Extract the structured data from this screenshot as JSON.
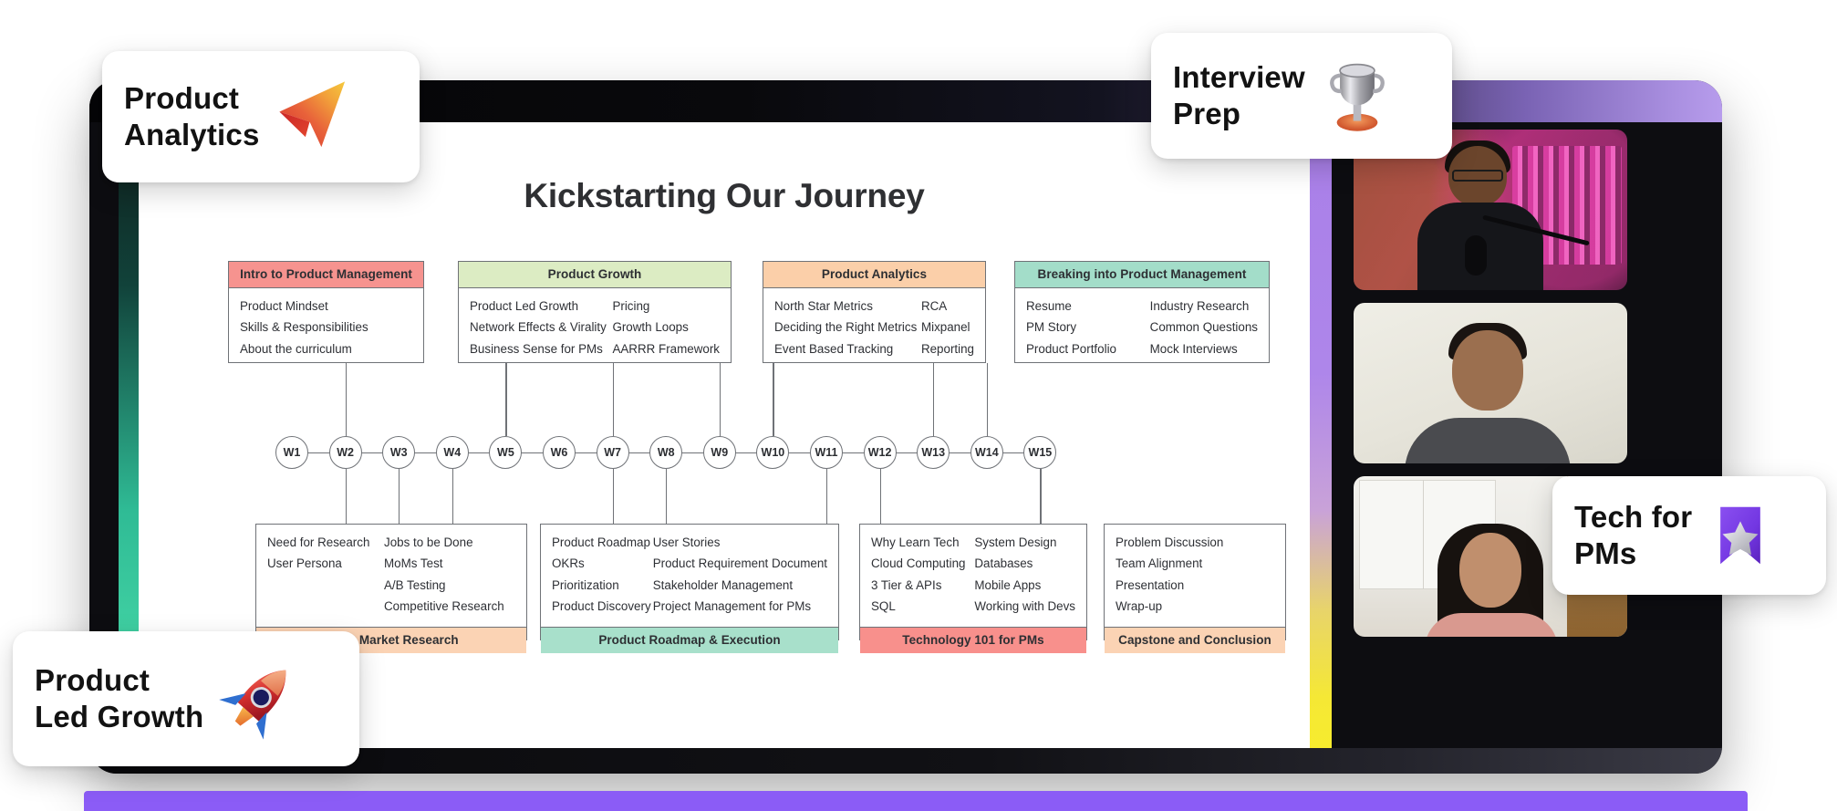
{
  "slide": {
    "title": "Kickstarting Our Journey",
    "modules_top": [
      {
        "title": "Intro to Product Management",
        "color": "#f6938f",
        "columns": [
          [
            "Product Mindset",
            "Skills & Responsibilities",
            "About the curriculum"
          ]
        ]
      },
      {
        "title": "Product Growth",
        "color": "#dcecc3",
        "columns": [
          [
            "Product Led Growth",
            "Network Effects & Virality",
            "Business Sense for PMs"
          ],
          [
            "Pricing",
            "Growth Loops",
            "AARRR Framework"
          ]
        ]
      },
      {
        "title": "Product Analytics",
        "color": "#fbcfa9",
        "columns": [
          [
            "North Star Metrics",
            "Deciding the Right Metrics",
            "Event Based Tracking"
          ],
          [
            "RCA",
            "Mixpanel",
            "Reporting"
          ]
        ]
      },
      {
        "title": "Breaking into Product Management",
        "color": "#a3ddc9",
        "columns": [
          [
            "Resume",
            "PM Story",
            "Product Portfolio"
          ],
          [
            "Industry Research",
            "Common Questions",
            "Mock Interviews"
          ]
        ]
      }
    ],
    "modules_bottom": [
      {
        "title": "rch & Market Research",
        "color": "#fbd3b4",
        "columns": [
          [
            "Need for Research",
            "User Persona"
          ],
          [
            "Jobs to be Done",
            "MoMs Test",
            "A/B Testing",
            "Competitive Research"
          ]
        ]
      },
      {
        "title": "Product Roadmap & Execution",
        "color": "#a8e0cb",
        "columns": [
          [
            "Product Roadmap",
            "OKRs",
            "Prioritization",
            "Product Discovery"
          ],
          [
            "User Stories",
            "Product Requirement Document",
            "Stakeholder Management",
            "Project Management for PMs"
          ]
        ]
      },
      {
        "title": "Technology 101 for PMs",
        "color": "#f8908c",
        "columns": [
          [
            "Why Learn Tech",
            "Cloud Computing",
            "3 Tier & APIs",
            "SQL"
          ],
          [
            "System Design",
            "Databases",
            "Mobile Apps",
            "Working with Devs"
          ]
        ]
      },
      {
        "title": "Capstone and Conclusion",
        "color": "#fbd3b4",
        "columns": [
          [
            "Problem Discussion",
            "Team Alignment",
            "Presentation",
            "Wrap-up"
          ]
        ]
      }
    ],
    "weeks": [
      "W1",
      "W2",
      "W3",
      "W4",
      "W5",
      "W6",
      "W7",
      "W8",
      "W9",
      "W10",
      "W11",
      "W12",
      "W13",
      "W14",
      "W15"
    ]
  },
  "floating_cards": [
    {
      "id": "product-analytics",
      "text": "Product\nAnalytics",
      "icon": "cursor-arrow-icon"
    },
    {
      "id": "interview-prep",
      "text": "Interview\nPrep",
      "icon": "trophy-icon"
    },
    {
      "id": "tech-for-pms",
      "text": "Tech for\nPMs",
      "icon": "bookmark-star-icon"
    },
    {
      "id": "product-led-growth",
      "text": "Product\nLed Growth",
      "icon": "rocket-icon"
    }
  ],
  "videos": [
    {
      "id": "participant-1",
      "name": "participant-video-tile-1"
    },
    {
      "id": "participant-2",
      "name": "participant-video-tile-2"
    },
    {
      "id": "participant-3",
      "name": "participant-video-tile-3"
    }
  ],
  "colors": {
    "accent_left_gradient": "#2fbb95",
    "accent_right_gradient": "#a97fe8",
    "bottom_bar": "#8b5cf6",
    "bezel": "#0d0d11"
  }
}
